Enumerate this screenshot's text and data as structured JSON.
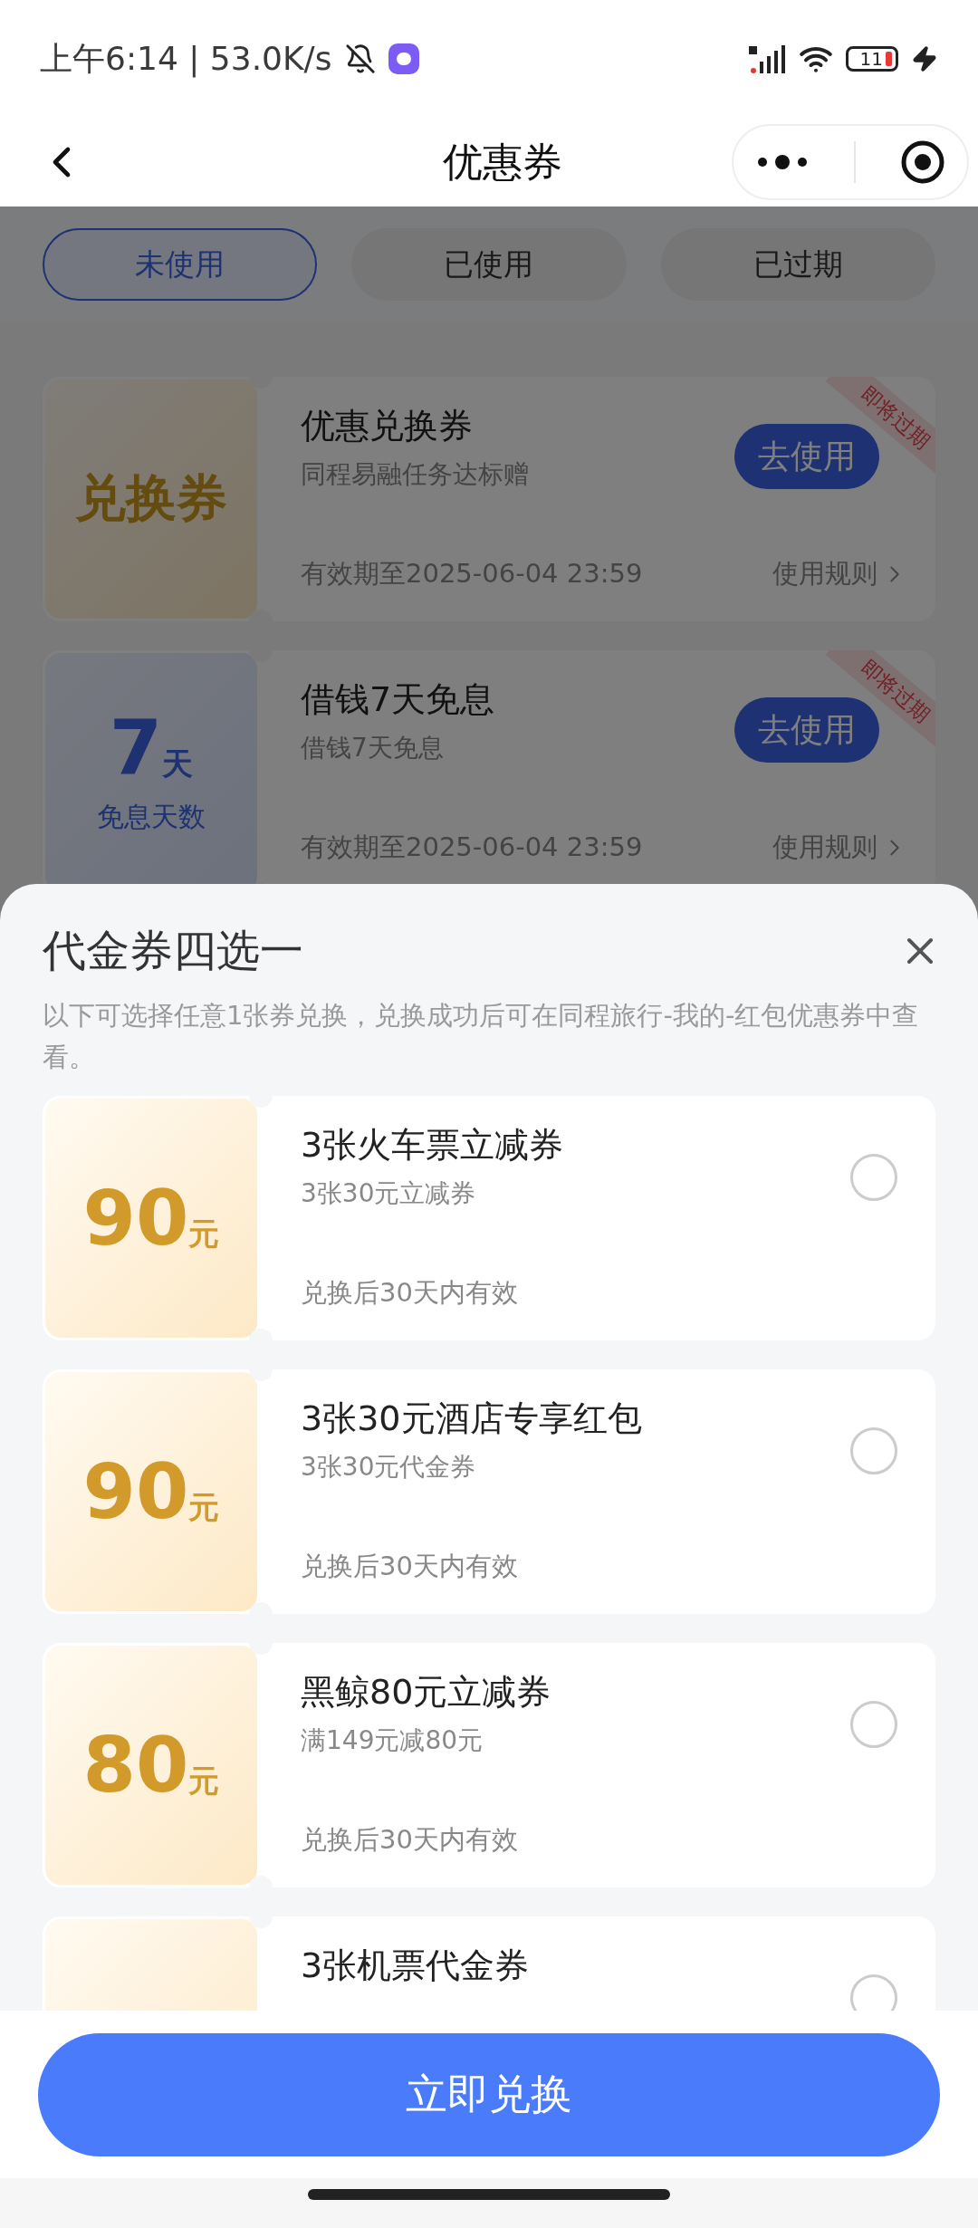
{
  "status_bar": {
    "time": "上午6:14 | 53.0K/s",
    "battery": "11"
  },
  "nav": {
    "title": "优惠券"
  },
  "tabs": [
    {
      "label": "未使用",
      "selected": true
    },
    {
      "label": "已使用",
      "selected": false
    },
    {
      "label": "已过期",
      "selected": false
    }
  ],
  "coupons": [
    {
      "kind": "exchange",
      "badge": "兑换券",
      "title": "优惠兑换券",
      "subtitle": "同程易融任务达标赠",
      "validity": "有效期至2025-06-04 23:59",
      "action": "去使用",
      "rules": "使用规则",
      "tag": "即将过期"
    },
    {
      "kind": "days",
      "amount": "7",
      "unit": "天",
      "caption": "免息天数",
      "title": "借钱7天免息",
      "subtitle": "借钱7天免息",
      "validity": "有效期至2025-06-04 23:59",
      "action": "去使用",
      "rules": "使用规则",
      "tag": "即将过期"
    }
  ],
  "sheet": {
    "title": "代金券四选一",
    "description": "以下可选择任意1张券兑换，兑换成功后可在同程旅行-我的-红包优惠券中查看。",
    "options": [
      {
        "amount": "90",
        "unit": "元",
        "title": "3张火车票立减券",
        "subtitle": "3张30元立减券",
        "validity": "兑换后30天内有效",
        "selected": false
      },
      {
        "amount": "90",
        "unit": "元",
        "title": "3张30元酒店专享红包",
        "subtitle": "3张30元代金券",
        "validity": "兑换后30天内有效",
        "selected": false
      },
      {
        "amount": "80",
        "unit": "元",
        "title": "黑鲸80元立减券",
        "subtitle": "满149元减80元",
        "validity": "兑换后30天内有效",
        "selected": false
      },
      {
        "title": "3张机票代金券",
        "selected": false
      }
    ],
    "confirm": "立即兑换"
  }
}
